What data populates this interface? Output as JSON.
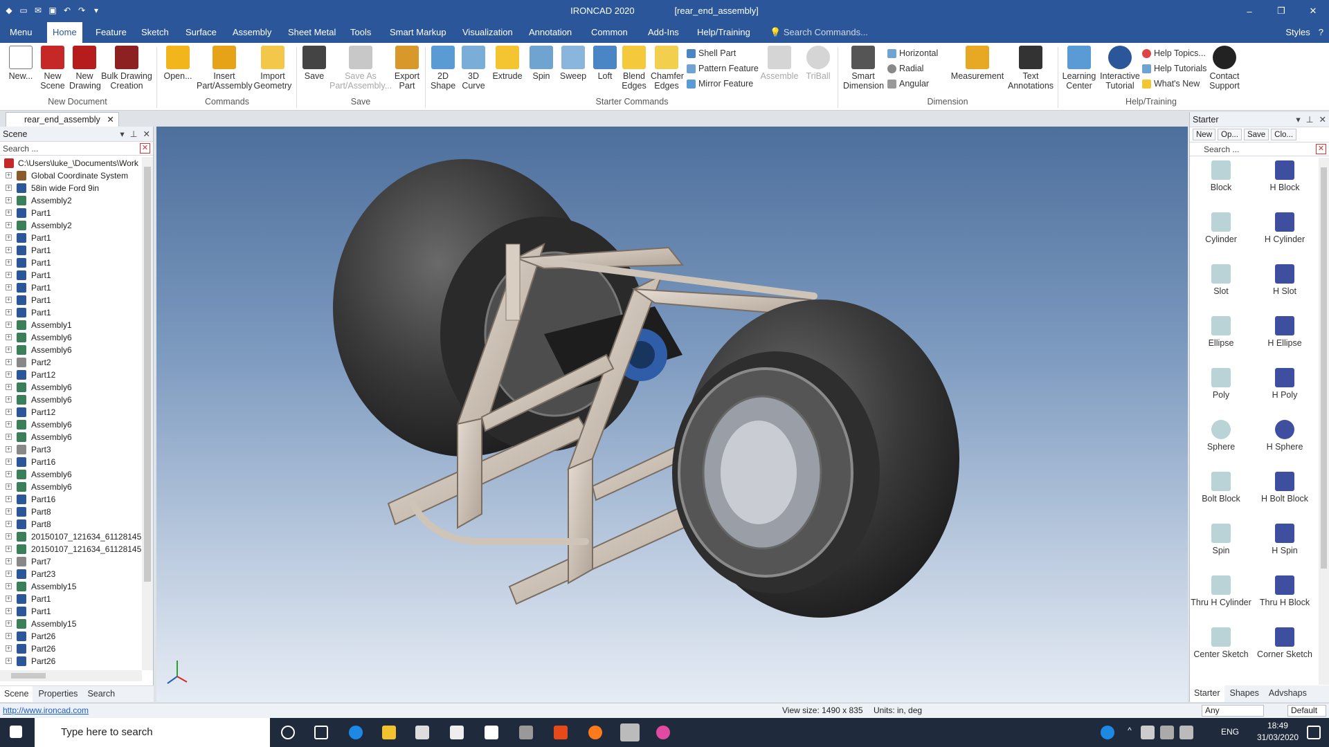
{
  "titlebar": {
    "app_name": "IRONCAD 2020",
    "doc_name": "[rear_end_assembly]",
    "minimize": "–",
    "restore": "❐",
    "close": "✕"
  },
  "menubar": {
    "tabs": [
      "Menu",
      "Home",
      "Feature",
      "Sketch",
      "Surface",
      "Assembly",
      "Sheet Metal",
      "Tools",
      "Smart Markup",
      "Visualization",
      "Annotation",
      "Common",
      "Add-Ins",
      "Help/Training"
    ],
    "active_tab": "Home",
    "search_placeholder": "Search Commands...",
    "styles_label": "Styles",
    "help_glyph": "?"
  },
  "ribbon": {
    "new_document": {
      "label": "New Document",
      "new": "New...",
      "new_scene": "New Scene",
      "new_drawing": "New Drawing",
      "bulk_drawing": "Bulk Drawing Creation"
    },
    "commands": {
      "label": "Commands",
      "open": "Open...",
      "insert": "Insert Part/Assembly",
      "import": "Import Geometry"
    },
    "save": {
      "label": "Save",
      "save": "Save",
      "save_as": "Save As Part/Assembly...",
      "export": "Export Part"
    },
    "starter": {
      "label": "Starter Commands",
      "shape2d": "2D Shape",
      "curve3d": "3D Curve",
      "extrude": "Extrude",
      "spin": "Spin",
      "sweep": "Sweep",
      "loft": "Loft",
      "blend": "Blend Edges",
      "chamfer": "Chamfer Edges",
      "shell": "Shell Part",
      "pattern": "Pattern Feature",
      "mirror": "Mirror Feature",
      "assemble": "Assemble",
      "triball": "TriBall"
    },
    "dimension": {
      "label": "Dimension",
      "smart": "Smart Dimension",
      "horizontal": "Horizontal",
      "radial": "Radial",
      "angular": "Angular",
      "measurement": "Measurement",
      "text": "Text Annotations"
    },
    "help": {
      "label": "Help/Training",
      "learning": "Learning Center",
      "tutorial": "Interactive Tutorial",
      "topics": "Help Topics...",
      "tutorials": "Help Tutorials",
      "whatsnew": "What's New",
      "contact": "Contact Support"
    }
  },
  "document_tab": {
    "name": "rear_end_assembly",
    "close": "✕"
  },
  "scene_panel": {
    "title": "Scene",
    "search_placeholder": "Search ...",
    "root": "C:\\Users\\luke_\\Documents\\Work",
    "items": [
      {
        "label": "Global Coordinate System",
        "kind": "coord"
      },
      {
        "label": "58in wide Ford 9in",
        "kind": "part"
      },
      {
        "label": "Assembly2",
        "kind": "assembly"
      },
      {
        "label": "Part1",
        "kind": "part"
      },
      {
        "label": "Assembly2",
        "kind": "assembly"
      },
      {
        "label": "Part1",
        "kind": "part"
      },
      {
        "label": "Part1",
        "kind": "part"
      },
      {
        "label": "Part1",
        "kind": "part"
      },
      {
        "label": "Part1",
        "kind": "part"
      },
      {
        "label": "Part1",
        "kind": "part"
      },
      {
        "label": "Part1",
        "kind": "part"
      },
      {
        "label": "Part1",
        "kind": "part"
      },
      {
        "label": "Assembly1",
        "kind": "assembly"
      },
      {
        "label": "Assembly6",
        "kind": "assembly"
      },
      {
        "label": "Assembly6",
        "kind": "assembly"
      },
      {
        "label": "Part2",
        "kind": "sketch"
      },
      {
        "label": "Part12",
        "kind": "part"
      },
      {
        "label": "Assembly6",
        "kind": "assembly"
      },
      {
        "label": "Assembly6",
        "kind": "assembly"
      },
      {
        "label": "Part12",
        "kind": "part"
      },
      {
        "label": "Assembly6",
        "kind": "assembly"
      },
      {
        "label": "Assembly6",
        "kind": "assembly"
      },
      {
        "label": "Part3",
        "kind": "sketch"
      },
      {
        "label": "Part16",
        "kind": "part"
      },
      {
        "label": "Assembly6",
        "kind": "assembly"
      },
      {
        "label": "Assembly6",
        "kind": "assembly"
      },
      {
        "label": "Part16",
        "kind": "part"
      },
      {
        "label": "Part8",
        "kind": "part"
      },
      {
        "label": "Part8",
        "kind": "part"
      },
      {
        "label": "20150107_121634_61128145",
        "kind": "assembly"
      },
      {
        "label": "20150107_121634_61128145",
        "kind": "assembly"
      },
      {
        "label": "Part7",
        "kind": "sketch"
      },
      {
        "label": "Part23",
        "kind": "part"
      },
      {
        "label": "Assembly15",
        "kind": "assembly"
      },
      {
        "label": "Part1",
        "kind": "part"
      },
      {
        "label": "Part1",
        "kind": "part"
      },
      {
        "label": "Assembly15",
        "kind": "assembly"
      },
      {
        "label": "Part26",
        "kind": "part"
      },
      {
        "label": "Part26",
        "kind": "part"
      },
      {
        "label": "Part26",
        "kind": "part"
      }
    ],
    "tabs": [
      "Scene",
      "Properties",
      "Search"
    ]
  },
  "starter_panel": {
    "title": "Starter",
    "buttons": [
      "New",
      "Op...",
      "Save",
      "Clo..."
    ],
    "search_placeholder": "Search ...",
    "shapes": [
      [
        "Block",
        "H Block"
      ],
      [
        "Cylinder",
        "H Cylinder"
      ],
      [
        "Slot",
        "H Slot"
      ],
      [
        "Ellipse",
        "H Ellipse"
      ],
      [
        "Poly",
        "H Poly"
      ],
      [
        "Sphere",
        "H Sphere"
      ],
      [
        "Bolt Block",
        "H Bolt Block"
      ],
      [
        "Spin",
        "H Spin"
      ],
      [
        "Thru H Cylinder",
        "Thru H Block"
      ],
      [
        "Center Sketch",
        "Corner Sketch"
      ]
    ],
    "tabs": [
      "Starter",
      "Shapes",
      "Advshaps"
    ]
  },
  "statusbar": {
    "link": "http://www.ironcad.com",
    "view_size": "View size: 1490 x  835",
    "units": "Units:   in, deg",
    "filter": "Any",
    "style": "Default"
  },
  "taskbar": {
    "search_placeholder": "Type here to search",
    "lang": "ENG",
    "time": "18:49",
    "date": "31/03/2020"
  },
  "colors": {
    "title_blue": "#2b579a",
    "viewport_top": "#4d6f9c",
    "viewport_bottom": "#e6ecf4"
  }
}
